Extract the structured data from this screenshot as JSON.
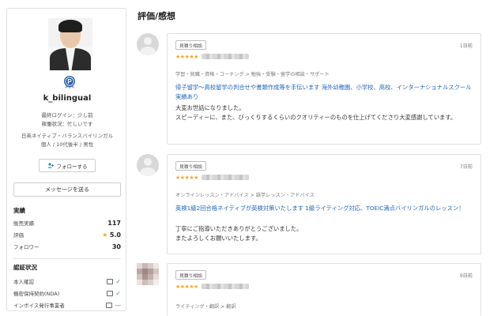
{
  "profile": {
    "username": "k_bilingual",
    "last_login": "最終ログイン：少し前",
    "busy_status": "稼働状況：忙しいです",
    "languages": "日英ネイティブ・バランスバイリンガル",
    "demographics": "個人 / 10代後半 / 男性",
    "follow_label": "フォローする",
    "message_label": "メッセージを送る",
    "badge_letter": "P"
  },
  "stats": {
    "title": "実績",
    "items": [
      {
        "label": "販売実績",
        "value": "117"
      },
      {
        "label": "評価",
        "value": "5.0"
      },
      {
        "label": "フォロワー",
        "value": "30"
      }
    ]
  },
  "certifications": {
    "title": "認証状況",
    "items": [
      {
        "label": "本人確認",
        "status": "✓"
      },
      {
        "label": "機密保持契約(NDA)",
        "status": "✓"
      },
      {
        "label": "インボイス発行事業者",
        "status": "—"
      }
    ]
  },
  "reviews": {
    "title": "評価/感想",
    "items": [
      {
        "tag": "見積り相談",
        "date": "1日前",
        "stars": "★★★★★",
        "category": "学習・就職・資格・コーチング > 勉強・受験・留学の相談・サポート",
        "link_text": "帰子留学〜高校留学の判合せや書類作成等を手伝います 海外幼稚園、小学校、高校、インターナショナルスクール実績あり",
        "body": "大変お世話になりました。\nスピーディーに、また、びっくりするくらいのクオリティーのものを仕上げてくださり大変感謝しています。"
      },
      {
        "tag": "見積り相談",
        "date": "7日前",
        "stars": "★★★★★",
        "category": "オンラインレッスン・アドバイス > 語学レッスン・アドバイス",
        "link_text": "英検1級2回合格ネイティブが英検対策いたします 1級ライティング対応、TOEIC満点バイリンガルのレッスン！",
        "body": "丁寧にご指導いただきありがとうございました。\nまたよろしくお願いいたします。"
      },
      {
        "tag": "見積り相談",
        "date": "9日前",
        "stars": "★★★★★",
        "category": "ライティング・翻訳 > 翻訳",
        "link_text": "",
        "body": ""
      }
    ]
  },
  "colors": {
    "star": "#f6a623",
    "link": "#2266bb",
    "check": "#3aa35a",
    "badge": "#2b5ea8"
  }
}
